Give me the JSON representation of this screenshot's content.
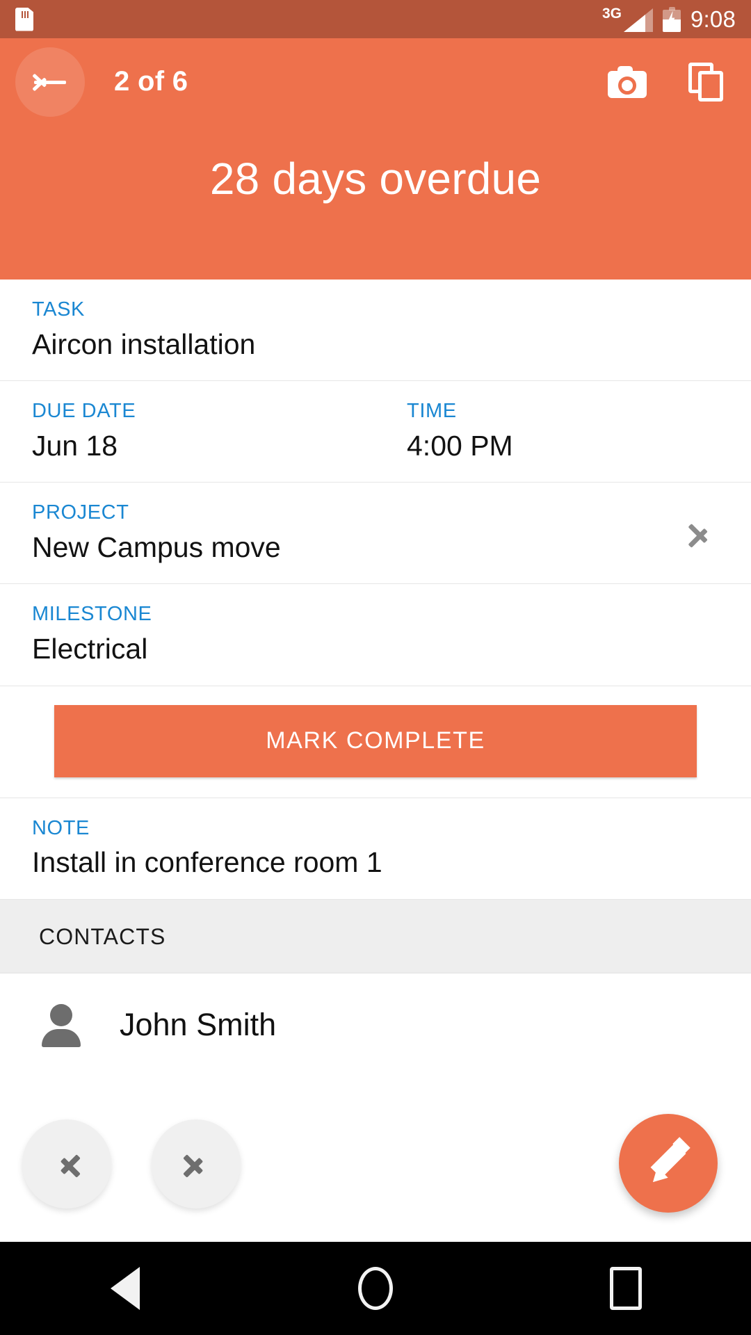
{
  "status_bar": {
    "sd_card_icon": "sd-card-icon",
    "network_label": "3G",
    "signal_icon": "signal-bars-icon",
    "battery_icon": "battery-charging-icon",
    "time": "9:08",
    "background_color": "#b4553a"
  },
  "app_bar": {
    "back_icon": "arrow-left-icon",
    "title": "2 of 6",
    "camera_icon": "camera-icon",
    "duplicate_icon": "copy-icon",
    "overdue_banner": "28 days overdue",
    "background_color": "#ee714c"
  },
  "details": {
    "task": {
      "label": "TASK",
      "value": "Aircon installation"
    },
    "due_date": {
      "label": "DUE DATE",
      "value": "Jun 18"
    },
    "time": {
      "label": "TIME",
      "value": "4:00 PM"
    },
    "project": {
      "label": "PROJECT",
      "value": "New Campus move",
      "chevron_icon": "chevron-right-icon"
    },
    "milestone": {
      "label": "MILESTONE",
      "value": "Electrical"
    },
    "note": {
      "label": "NOTE",
      "value": "Install in conference room 1"
    },
    "label_color": "#1a87d2",
    "value_color": "#121212"
  },
  "mark_complete": {
    "label": "MARK COMPLETE",
    "color": "#ee714c"
  },
  "contacts": {
    "header": "CONTACTS",
    "header_background": "#eeeeee",
    "items": [
      {
        "avatar_icon": "person-icon",
        "name": "John Smith"
      }
    ]
  },
  "fabs": {
    "previous": {
      "icon": "chevron-left-icon",
      "color": "#f0f0f0"
    },
    "next": {
      "icon": "chevron-right-icon",
      "color": "#f0f0f0"
    },
    "edit": {
      "icon": "pencil-icon",
      "color": "#ee714c"
    }
  },
  "android_nav": {
    "back_icon": "triangle-back-icon",
    "home_icon": "circle-home-icon",
    "recents_icon": "square-recents-icon",
    "background_color": "#000000"
  }
}
